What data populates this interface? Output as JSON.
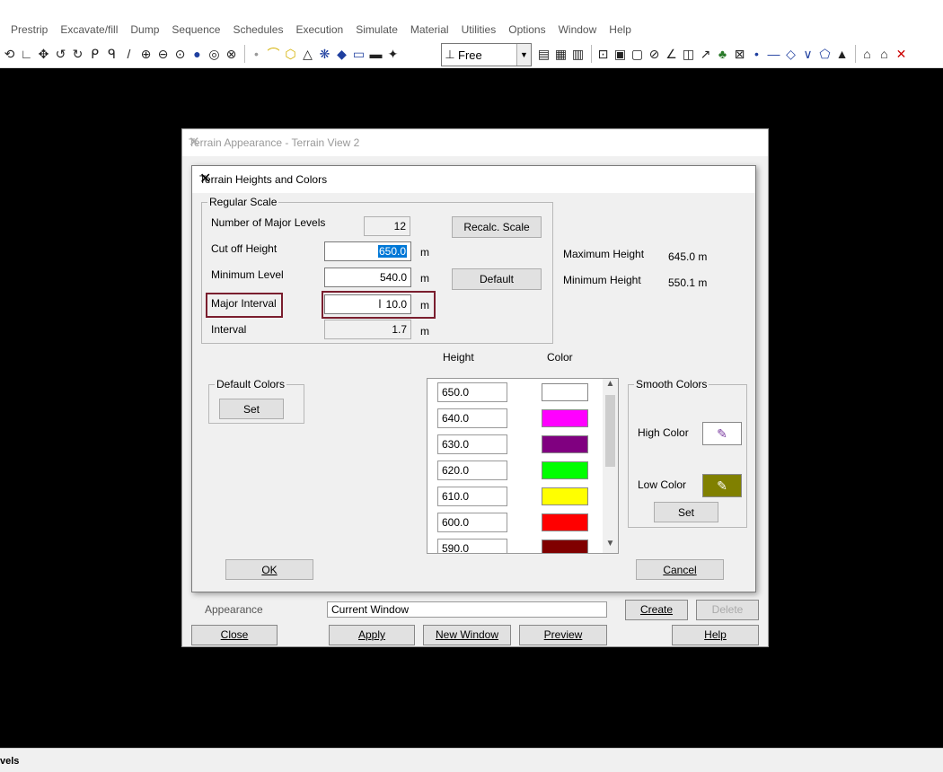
{
  "menu": [
    "Prestrip",
    "Excavate/fill",
    "Dump",
    "Sequence",
    "Schedules",
    "Execution",
    "Simulate",
    "Material",
    "Utilities",
    "Options",
    "Window",
    "Help"
  ],
  "toolbar": {
    "view_mode": "Free"
  },
  "back_dialog": {
    "title": "Terrain Appearance - Terrain View 2",
    "appearance_label": "Appearance",
    "appearance_value": "Current Window",
    "buttons": {
      "create": "Create",
      "delete": "Delete",
      "close": "Close",
      "apply": "Apply",
      "new_window": "New Window",
      "preview": "Preview",
      "help": "Help"
    }
  },
  "dialog": {
    "title": "Terrain Heights and Colors",
    "regular_scale": {
      "legend": "Regular Scale",
      "num_major_levels_label": "Number of  Major Levels",
      "num_major_levels": "12",
      "cutoff_label": "Cut off Height",
      "cutoff": "650.0",
      "min_level_label": "Minimum Level",
      "min_level": "540.0",
      "major_interval_label": "Major Interval",
      "major_interval": "10.0",
      "interval_label": "Interval",
      "interval": "1.7",
      "unit": "m",
      "recalc_button": "Recalc. Scale",
      "default_button": "Default"
    },
    "stats": {
      "max_label": "Maximum  Height",
      "max_value": "645.0 m",
      "min_label": "Minimum Height",
      "min_value": "550.1 m"
    },
    "table_headers": {
      "height": "Height",
      "color": "Color"
    },
    "levels": [
      {
        "height": "650.0",
        "color": "#ffffff"
      },
      {
        "height": "640.0",
        "color": "#ff00ff"
      },
      {
        "height": "630.0",
        "color": "#800080"
      },
      {
        "height": "620.0",
        "color": "#00ff00"
      },
      {
        "height": "610.0",
        "color": "#ffff00"
      },
      {
        "height": "600.0",
        "color": "#ff0000"
      },
      {
        "height": "590.0",
        "color": "#800000"
      }
    ],
    "default_colors": {
      "legend": "Default Colors",
      "set_button": "Set"
    },
    "smooth_colors": {
      "legend": "Smooth Colors",
      "high_label": "High Color",
      "low_label": "Low Color",
      "high_color": "#ffffff",
      "low_color": "#808000",
      "set_button": "Set"
    },
    "ok_button": "OK",
    "cancel_button": "Cancel"
  },
  "status": {
    "text": "vels"
  }
}
